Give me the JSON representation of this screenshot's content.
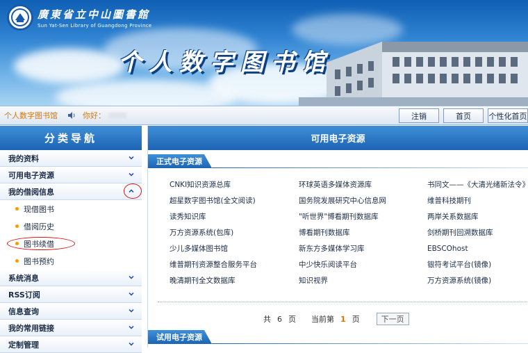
{
  "banner": {
    "logo_cn": "廣東省立中山圖書館",
    "logo_en": "Sun Yat-Sen Library of Guangdong Province",
    "title": "个人数字图书馆"
  },
  "topbar": {
    "site_name": "个人数字图书馆",
    "greeting": "你好：",
    "buttons": [
      {
        "label": "注销"
      },
      {
        "label": "首页"
      },
      {
        "label": "个性化首页"
      }
    ]
  },
  "sidebar": {
    "title": "分类导航",
    "items": [
      {
        "label": "我的资料",
        "state": "collapsed"
      },
      {
        "label": "可用电子资源",
        "state": "collapsed"
      },
      {
        "label": "我的借阅信息",
        "state": "expanded"
      }
    ],
    "subitems": [
      {
        "label": "现借图书"
      },
      {
        "label": "借阅历史"
      },
      {
        "label": "图书续借"
      },
      {
        "label": "图书预约"
      }
    ],
    "items_after": [
      {
        "label": "系统消息"
      },
      {
        "label": "RSS订阅"
      },
      {
        "label": "信息查询"
      },
      {
        "label": "我的常用链接"
      },
      {
        "label": "定制管理"
      }
    ]
  },
  "main": {
    "title": "可用电子资源",
    "formal_section": "正式电子资源",
    "trial_section": "试用电子资源",
    "resources": [
      [
        "CNKI知识资源总库",
        "环球英语多媒体资源库",
        "书同文——《大清光绪新法令》全文"
      ],
      [
        "超星数字图书馆(全文阅读)",
        "国务院发展研究中心信息网",
        "维普科技期刊"
      ],
      [
        "读秀知识库",
        "\"听世界\"博看期刊数据库",
        "两岸关系数据库"
      ],
      [
        "万方资源系统(包库)",
        "博看期刊数据库",
        "剑桥期刊回溯数据库"
      ],
      [
        "少儿多媒体图书馆",
        "新东方多媒体学习库",
        "EBSCOhost"
      ],
      [
        "维普期刊资源整合服务平台",
        "中少快乐阅读平台",
        "银符考试平台(镜像)"
      ],
      [
        "晚清期刊全文数据库",
        "知识视界",
        "万方资源系统(镜像)"
      ]
    ],
    "pager": {
      "total_prefix": "共",
      "total_pages": "6",
      "total_suffix": "页",
      "current_prefix": "当前第",
      "current_page": "1",
      "current_suffix": "页",
      "next_label": "下一页"
    }
  },
  "colors": {
    "accent_blue": "#1d64b4",
    "orange_text": "#e07400",
    "highlight_ring": "#dd1111"
  }
}
